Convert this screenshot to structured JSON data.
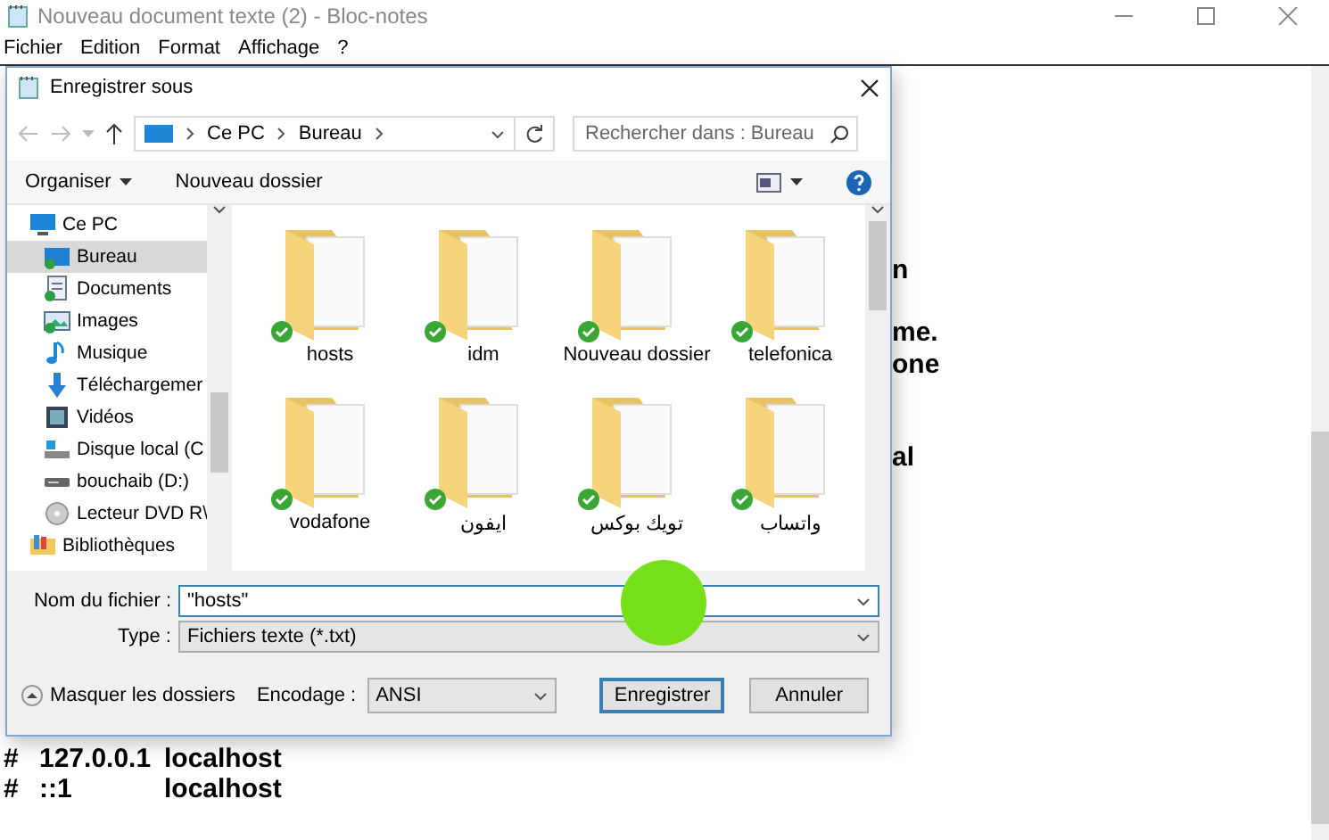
{
  "window": {
    "title": "Nouveau document texte (2) - Bloc-notes",
    "menu": [
      "Fichier",
      "Edition",
      "Format",
      "Affichage",
      "?"
    ]
  },
  "document": {
    "fragments": [
      "n",
      "me.",
      "one",
      "al"
    ],
    "lines": [
      {
        "cells": [
          "#",
          "127.0.0.1",
          "localhost"
        ]
      },
      {
        "cells": [
          "#",
          "::1",
          "localhost"
        ]
      }
    ]
  },
  "dialog": {
    "title": "Enregistrer sous",
    "breadcrumb": [
      "Ce PC",
      "Bureau"
    ],
    "search": {
      "placeholder": "Rechercher dans : Bureau"
    },
    "toolbar": {
      "organize": "Organiser",
      "new_folder": "Nouveau dossier"
    },
    "nav": [
      {
        "label": "Ce PC",
        "kind": "pc",
        "selected": false,
        "children": [
          {
            "label": "Bureau",
            "kind": "desktop",
            "selected": true
          },
          {
            "label": "Documents",
            "kind": "documents",
            "selected": false
          },
          {
            "label": "Images",
            "kind": "images",
            "selected": false
          },
          {
            "label": "Musique",
            "kind": "music",
            "selected": false
          },
          {
            "label": "Téléchargemer",
            "kind": "downloads",
            "selected": false
          },
          {
            "label": "Vidéos",
            "kind": "videos",
            "selected": false
          },
          {
            "label": "Disque local (C",
            "kind": "drive",
            "selected": false
          },
          {
            "label": "bouchaib (D:)",
            "kind": "removable",
            "selected": false
          },
          {
            "label": "Lecteur DVD R\\",
            "kind": "dvd",
            "selected": false
          }
        ]
      },
      {
        "label": "Bibliothèques",
        "kind": "libraries",
        "selected": false
      }
    ],
    "folders": [
      {
        "name": "hosts",
        "synced": true
      },
      {
        "name": "idm",
        "synced": true
      },
      {
        "name": "Nouveau dossier",
        "synced": true
      },
      {
        "name": "telefonica",
        "synced": true
      },
      {
        "name": "vodafone",
        "synced": true
      },
      {
        "name": "ايفون",
        "synced": true
      },
      {
        "name": "تويك بوكس",
        "synced": true
      },
      {
        "name": "واتساب",
        "synced": true
      }
    ],
    "filename": {
      "label": "Nom du fichier :",
      "value": "\"hosts\""
    },
    "type": {
      "label": "Type :",
      "value": "Fichiers texte (*.txt)"
    },
    "hide_folders": "Masquer les dossiers",
    "encoding": {
      "label": "Encodage :",
      "value": "ANSI"
    },
    "buttons": [
      {
        "label": "Enregistrer",
        "default": true
      },
      {
        "label": "Annuler",
        "default": false
      }
    ]
  }
}
